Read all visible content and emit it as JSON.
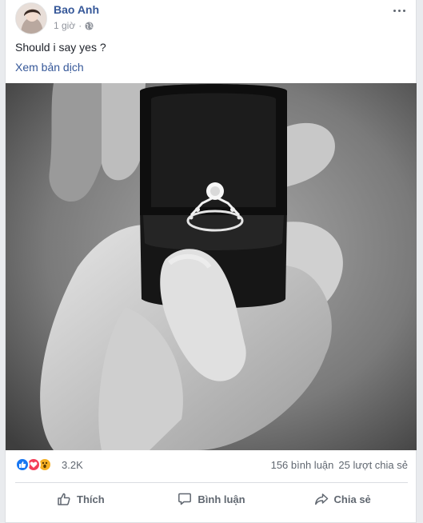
{
  "post": {
    "author": "Bao Anh",
    "time": "1 giờ",
    "caption": "Should i say yes ?",
    "translate_link": "Xem bản dịch"
  },
  "reactions": {
    "icons": [
      "like-icon",
      "love-icon",
      "wow-icon"
    ],
    "count": "3.2K",
    "comments": "156 bình luận",
    "shares": "25 lượt chia sẻ"
  },
  "actions": {
    "like": "Thích",
    "comment": "Bình luận",
    "share": "Chia sẻ"
  },
  "colors": {
    "name_link": "#365899",
    "meta_text": "#90949c",
    "like_blue": "#1877f2",
    "love_red": "#f33e58",
    "wow_yellow": "#f7b125"
  }
}
